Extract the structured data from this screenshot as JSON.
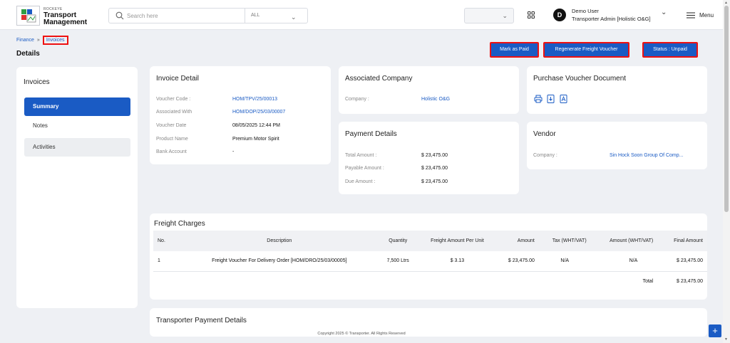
{
  "brand": {
    "small": "ROCKEYE",
    "title_line1": "Transport",
    "title_line2": "Management"
  },
  "search": {
    "placeholder": "Search here",
    "scope": "ALL"
  },
  "user": {
    "initial": "D",
    "name": "Demo User",
    "role": "Transporter Admin [Holistic O&G]"
  },
  "menu_label": "Menu",
  "breadcrumb": {
    "parent": "Finance",
    "current": "Invoices"
  },
  "page_title": "Details",
  "actions": {
    "mark_paid": "Mark as Paid",
    "regenerate": "Regenerate Freight Voucher",
    "status": "Status : Unpaid"
  },
  "sidebar": {
    "title": "Invoices",
    "items": [
      {
        "label": "Summary"
      },
      {
        "label": "Notes"
      },
      {
        "label": "Activities"
      }
    ]
  },
  "invoice_detail": {
    "title": "Invoice Detail",
    "rows": [
      {
        "label": "Voucher Code :",
        "value": "HOM/TPV/25/00013"
      },
      {
        "label": "Associated With",
        "value": "HOM/DOP/25/03/00007"
      },
      {
        "label": "Voucher Date",
        "value": "08/05/2025 12:44 PM"
      },
      {
        "label": "Product Name",
        "value": "Premium Motor Spirit"
      },
      {
        "label": "Bank Account",
        "value": "-"
      }
    ]
  },
  "associated_company": {
    "title": "Associated Company",
    "label": "Company :",
    "value": "Holistic O&G"
  },
  "payment_details": {
    "title": "Payment Details",
    "rows": [
      {
        "label": "Total Amount :",
        "value": "$ 23,475.00"
      },
      {
        "label": "Payable Amount :",
        "value": "$ 23,475.00"
      },
      {
        "label": "Due Amount :",
        "value": "$ 23,475.00"
      }
    ]
  },
  "purchase_voucher": {
    "title": "Purchase Voucher Document"
  },
  "vendor": {
    "title": "Vendor",
    "label": "Company :",
    "value": "Sin Hock Soon Group Of Comp..."
  },
  "freight_charges": {
    "title": "Freight Charges",
    "headers": [
      "No.",
      "Description",
      "Quantity",
      "Freight Amount Per Unit",
      "Amount",
      "Tax (WHT/VAT)",
      "Amount (WHT/VAT)",
      "Final Amount"
    ],
    "rows": [
      [
        "1",
        "Freight Voucher For Delivery Order [HOM/DRO/25/03/00005]",
        "7,500 Ltrs",
        "$ 3.13",
        "$ 23,475.00",
        "N/A",
        "N/A",
        "$ 23,475.00"
      ]
    ],
    "total_label": "Total",
    "total_value": "$ 23,475.00"
  },
  "transporter_payment": {
    "title": "Transporter Payment Details"
  },
  "footer": "Copyright 2025 © Transporter. All Rights Reserved",
  "colors": {
    "primary": "#1a5bc4",
    "highlight": "#e11111",
    "background": "#eef0f4"
  }
}
